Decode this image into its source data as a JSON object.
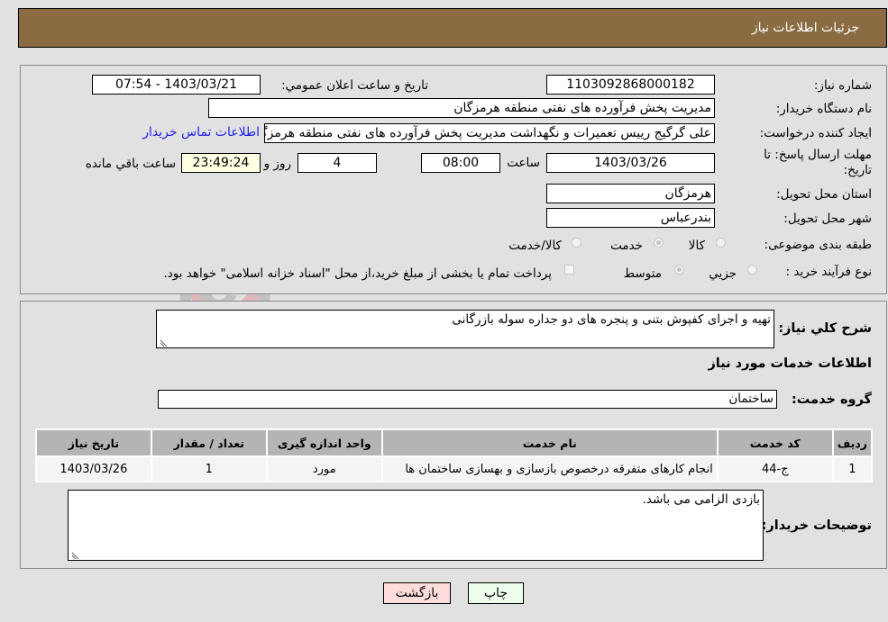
{
  "header": {
    "title": "جزئیات اطلاعات نیاز"
  },
  "form": {
    "need_number": {
      "label": "شماره نیاز:",
      "value": "1103092868000182"
    },
    "announce_datetime": {
      "label": "تاریخ و ساعت اعلان عمومي:",
      "value": "1403/03/21 - 07:54"
    },
    "buyer_org": {
      "label": "نام دستگاه خریدار:",
      "value": "مدیریت پخش فرآورده های نفتی منطقه هرمزگان"
    },
    "creator": {
      "label": "ایجاد کننده درخواست:",
      "value": "علی گرگیج رییس تعمیرات و نگهداشت مدیریت پخش فرآورده های نفتی منطقه هرمزگان"
    },
    "contact_link": "اطلاعات تماس خریدار",
    "deadline": {
      "label_line1": "مهلت ارسال پاسخ: تا",
      "label_line2": "تاریخ:",
      "date": "1403/03/26",
      "time_label": "ساعت",
      "time": "08:00",
      "days": "4",
      "days_label": "روز و",
      "remaining": "23:49:24",
      "remaining_label": "ساعت باقي مانده"
    },
    "province": {
      "label": "استان محل تحویل:",
      "value": "هرمزگان"
    },
    "city": {
      "label": "شهر محل تحویل:",
      "value": "بندرعباس"
    },
    "category": {
      "label": "طبقه بندی موضوعی:",
      "options": [
        "کالا",
        "خدمت",
        "کالا/خدمت"
      ],
      "selected": "خدمت"
    },
    "purchase_type": {
      "label": "نوع فرآیند خرید :",
      "options": [
        "جزيي",
        "متوسط"
      ],
      "selected": "متوسط",
      "treasury_note": "پرداخت تمام یا بخشی از مبلغ خرید،از محل \"اسناد خزانه اسلامی\" خواهد بود."
    }
  },
  "details": {
    "description_label": "شرح كلي نياز:",
    "description": "تهیه و اجرای کفپوش بتنی و پنجره های دو جداره سوله بازرگانی",
    "services_heading": "اطلاعات خدمات مورد نیاز",
    "service_group_label": "گروه خدمت:",
    "service_group": "ساختمان",
    "table": {
      "headers": [
        "ردیف",
        "کد خدمت",
        "نام خدمت",
        "واحد اندازه گیری",
        "تعداد / مقدار",
        "تاریخ نیاز"
      ],
      "rows": [
        [
          "1",
          "ج-44",
          "انجام کارهای متفرقه درخصوص بازسازی و بهسازی ساختمان ها",
          "مورد",
          "1",
          "1403/03/26"
        ]
      ]
    },
    "buyer_notes_label": "توضیحات خریدار:",
    "buyer_notes": "بازدی الزامی می باشد."
  },
  "buttons": {
    "print": "چاپ",
    "back": "بازگشت"
  },
  "colors": {
    "header_bg": "#8b6c42",
    "print_bg": "#eeffee",
    "back_bg": "#ffdddd",
    "link": "#2222ee"
  },
  "watermark": {
    "text": "AriaTender.neT"
  }
}
